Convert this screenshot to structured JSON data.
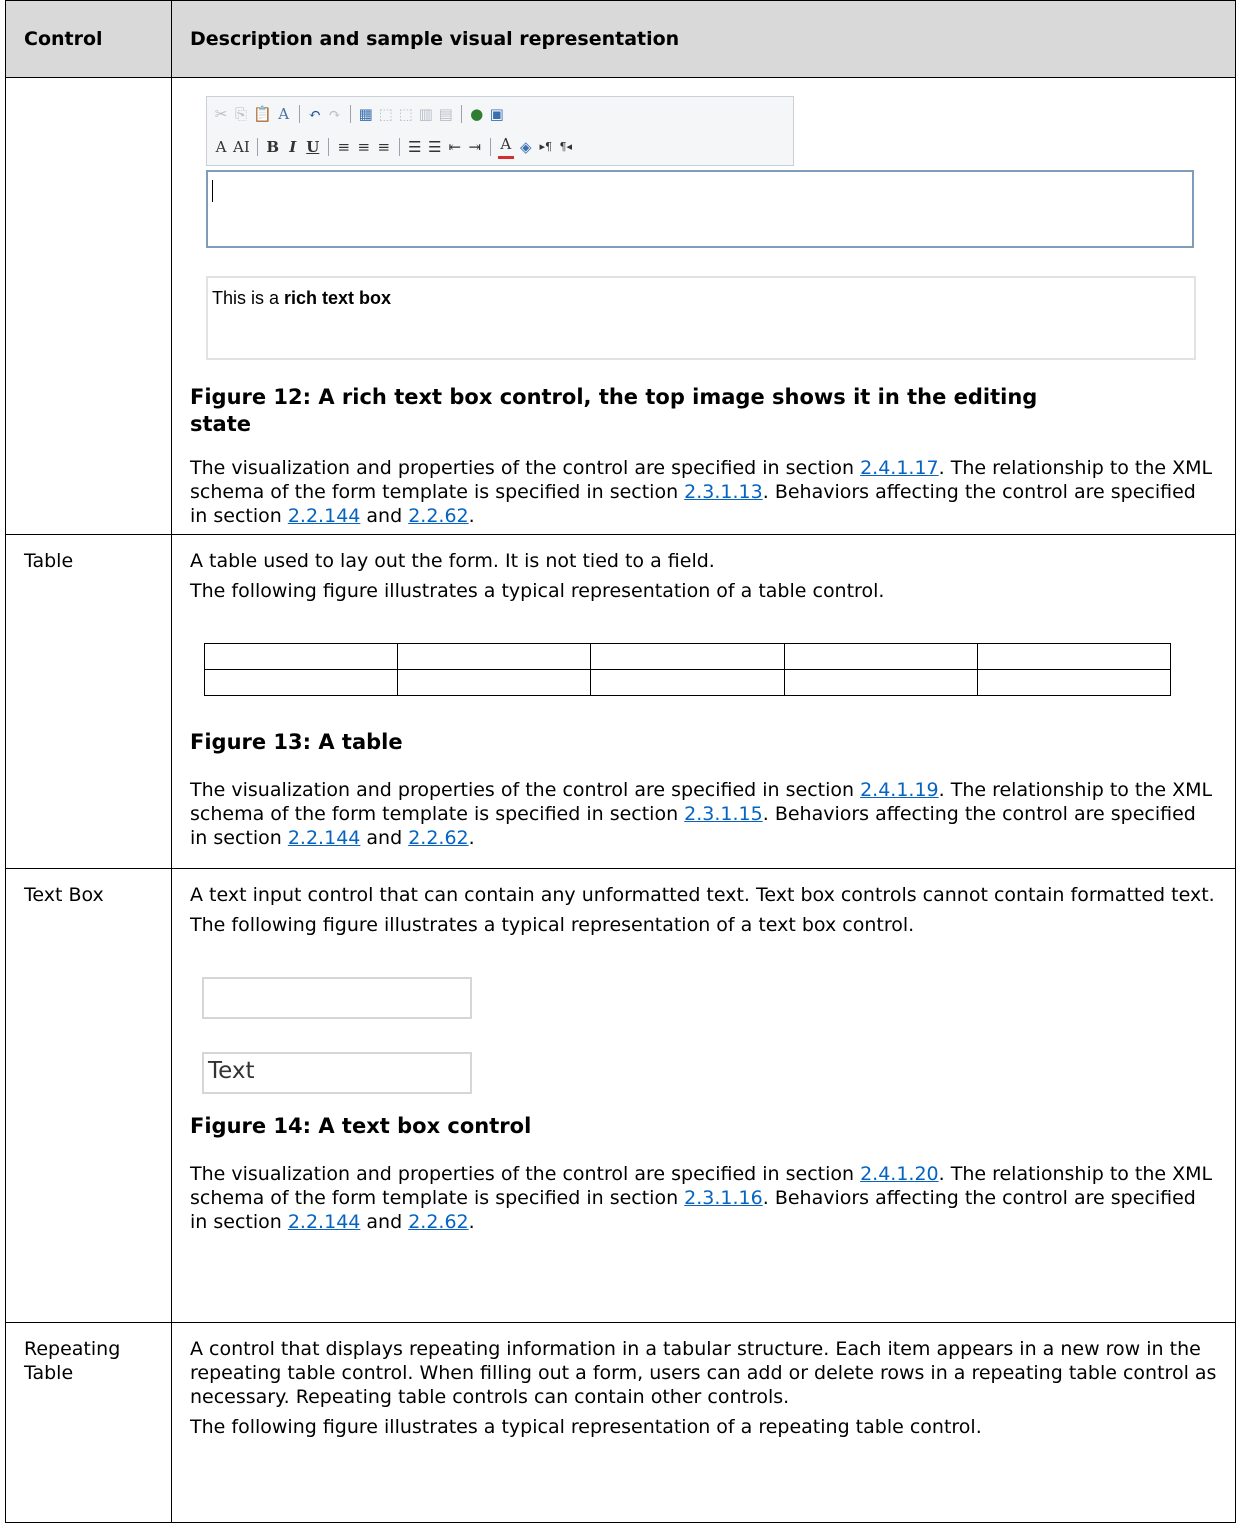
{
  "header": {
    "col1": "Control",
    "col2": "Description and sample visual representation"
  },
  "rich_text": {
    "toolbar_row1": [
      "✂",
      "⎘",
      "📋",
      "A",
      "↶",
      "↷",
      "▦",
      "⬚",
      "⬚",
      "▥",
      "▤",
      "●",
      "▣"
    ],
    "toolbar_row2": [
      "A",
      "AI",
      "B",
      "I",
      "U",
      "≡",
      "≡",
      "≡",
      "☰",
      "☰",
      "⇤",
      "⇥",
      "A",
      "◈",
      "▸¶",
      "¶◂"
    ],
    "view_text_normal": "This is a ",
    "view_text_bold": "rich text box",
    "figure_caption_line1": "Figure 12: A rich text box control, the top image shows it in the editing",
    "figure_caption_line2": "state",
    "desc_a": "The visualization and properties of the control are specified in section ",
    "link1": "2.4.1.17",
    "desc_b": ". The relationship to the XML schema of the form template is specified in section ",
    "link2": "2.3.1.13",
    "desc_c": ". Behaviors affecting the control are specified in section ",
    "link3": "2.2.144",
    "desc_d": " and ",
    "link4": "2.2.62",
    "desc_e": "."
  },
  "table_row": {
    "control": "Table",
    "line1": "A table used to lay out the form. It is not tied to a field.",
    "line2": "The following figure illustrates a typical representation of a table control.",
    "figure_caption": "Figure 13: A table",
    "desc_a": "The visualization and properties of the control are specified in section ",
    "link1": "2.4.1.19",
    "desc_b": ". The relationship to the XML schema of the form template is specified in section ",
    "link2": "2.3.1.15",
    "desc_c": ". Behaviors affecting the control are specified in section ",
    "link3": "2.2.144",
    "desc_d": " and ",
    "link4": "2.2.62",
    "desc_e": "."
  },
  "text_box_row": {
    "control": "Text Box",
    "line1": "A text input control that can contain any unformatted text. Text box controls cannot contain formatted text.",
    "line2": "The following figure illustrates a typical representation of a text box control.",
    "sample_value": "Text",
    "figure_caption": "Figure 14: A text box control",
    "desc_a": "The visualization and properties of the control are specified in section ",
    "link1": "2.4.1.20",
    "desc_b": ". The relationship to the XML schema of the form template is specified in section ",
    "link2": "2.3.1.16",
    "desc_c": ". Behaviors affecting the control are specified in section ",
    "link3": "2.2.144",
    "desc_d": " and ",
    "link4": "2.2.62",
    "desc_e": "."
  },
  "repeating_row": {
    "control": "Repeating Table",
    "line1": "A control that displays repeating information in a tabular structure. Each item appears in a new row in the repeating table control. When filling out a form, users can add or delete rows in a repeating table control as necessary. Repeating table controls can contain other controls.",
    "line2": "The following figure illustrates a typical representation of a repeating table control."
  }
}
